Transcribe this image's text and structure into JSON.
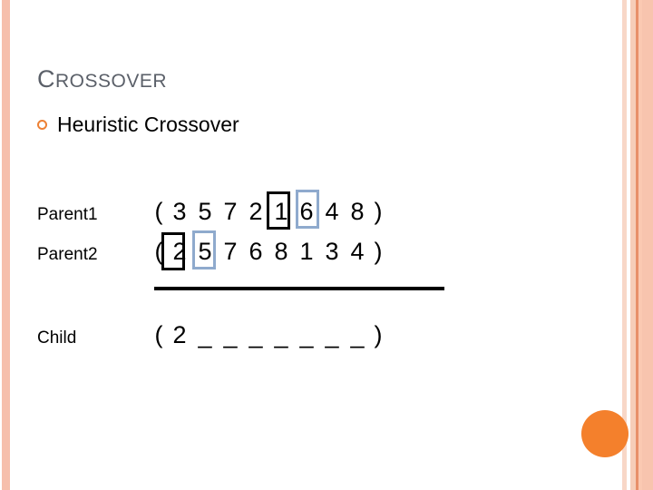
{
  "slide": {
    "title_first_letter": "C",
    "title_rest": "ROSSOVER",
    "title_full": "CROSSOVER",
    "bullet": {
      "marker": "hollow-circle-bullet",
      "text": "Heuristic Crossover"
    },
    "accent_color": "#ed8135",
    "title_color": "#5b6069",
    "circle_color": "#f4802c",
    "highlight_black": "#000000",
    "highlight_blue": "#8faacd"
  },
  "crossover_table": {
    "rows": [
      {
        "label": "Parent1",
        "open_paren": "(",
        "close_paren": ")",
        "genes": [
          "3",
          "5",
          "7",
          "2",
          "1",
          "6",
          "4",
          "8"
        ],
        "boxed_black_index": 3,
        "boxed_blue_index": 4
      },
      {
        "label": "Parent2",
        "open_paren": "(",
        "close_paren": ")",
        "genes": [
          "2",
          "5",
          "7",
          "6",
          "8",
          "1",
          "3",
          "4"
        ],
        "boxed_black_index": 0,
        "boxed_blue_index": 1
      },
      {
        "label": "Child",
        "open_paren": "(",
        "close_paren": ")",
        "genes": [
          "2",
          "_",
          "_",
          "_",
          "_",
          "_",
          "_",
          "_"
        ],
        "boxed_black_index": null,
        "boxed_blue_index": null
      }
    ],
    "separator": "horizontal-rule"
  }
}
